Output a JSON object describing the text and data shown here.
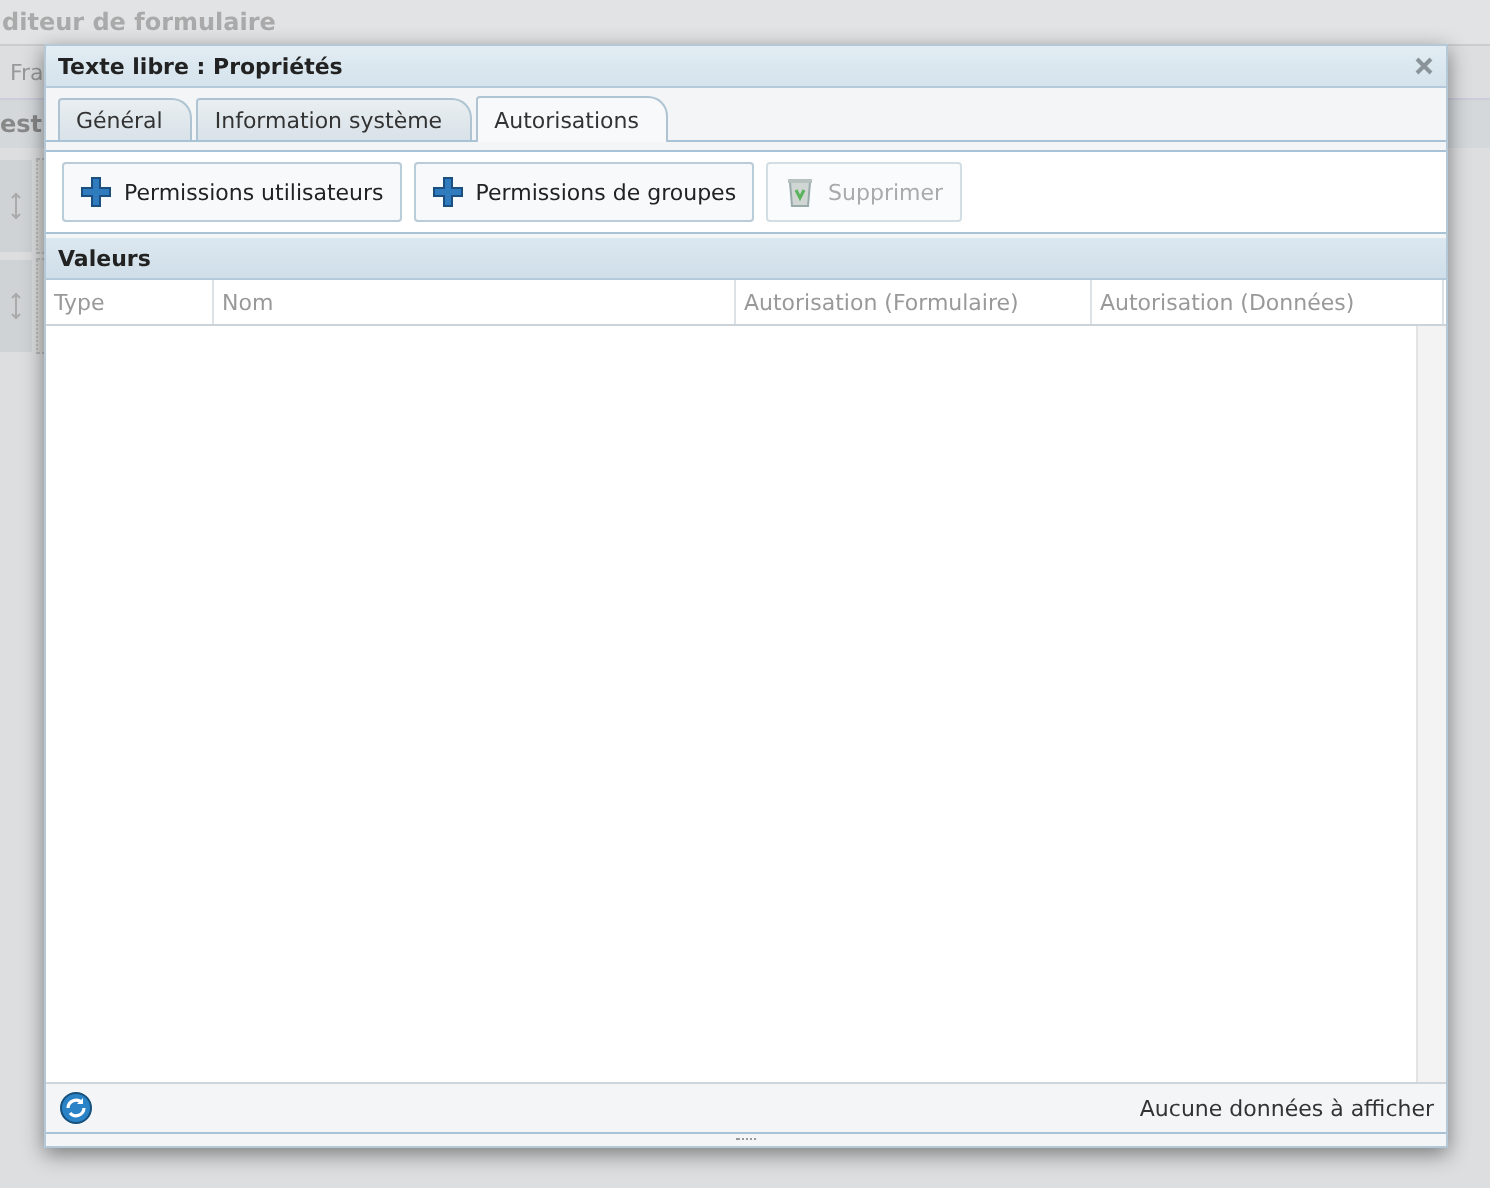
{
  "background": {
    "title": "diteur de formulaire",
    "toolbar_text": "Fra",
    "section_text": "est"
  },
  "dialog": {
    "title": "Texte libre : Propriétés",
    "tabs": [
      {
        "label": "Général",
        "selected": false
      },
      {
        "label": "Information système",
        "selected": false
      },
      {
        "label": "Autorisations",
        "selected": true
      }
    ],
    "buttons": [
      {
        "label": "Permissions utilisateurs",
        "kind": "add",
        "disabled": false
      },
      {
        "label": "Permissions de groupes",
        "kind": "add",
        "disabled": false
      },
      {
        "label": "Supprimer",
        "kind": "delete",
        "disabled": true
      }
    ],
    "grid": {
      "title": "Valeurs",
      "columns": [
        "Type",
        "Nom",
        "Autorisation (Formulaire)",
        "Autorisation (Données)"
      ]
    },
    "status": "Aucune données à afficher"
  }
}
